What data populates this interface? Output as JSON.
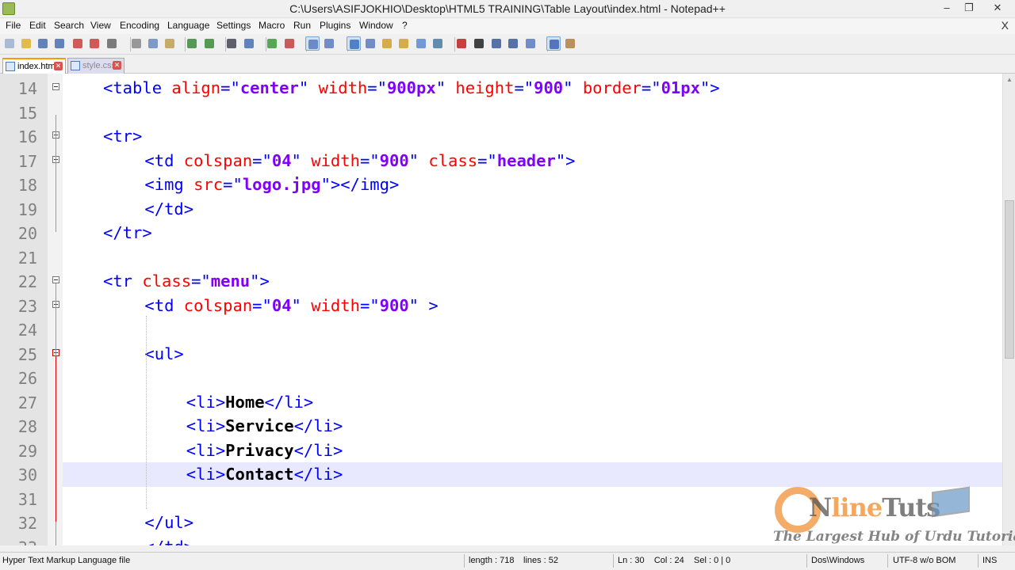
{
  "window": {
    "title": "C:\\Users\\ASIFJOKHIO\\Desktop\\HTML5 TRAINING\\Table Layout\\index.html - Notepad++",
    "controls": {
      "minimize": "–",
      "restore": "❐",
      "close": "✕"
    }
  },
  "menu": {
    "items": [
      "File",
      "Edit",
      "Search",
      "View",
      "Encoding",
      "Language",
      "Settings",
      "Macro",
      "Run",
      "Plugins",
      "Window",
      "?"
    ],
    "close_glyph": "X"
  },
  "tabs": [
    {
      "label": "index.html",
      "active": true
    },
    {
      "label": "style.css",
      "active": false
    }
  ],
  "editor": {
    "current_line": 30,
    "lines": [
      {
        "n": "14",
        "indent": "",
        "tokens": [
          [
            "tg",
            "<table "
          ],
          [
            "at",
            "align"
          ],
          [
            "tg",
            "=\""
          ],
          [
            "st",
            "center"
          ],
          [
            "tg",
            "\" "
          ],
          [
            "at",
            "width"
          ],
          [
            "tg",
            "=\""
          ],
          [
            "st",
            "900px"
          ],
          [
            "tg",
            "\" "
          ],
          [
            "at",
            "height"
          ],
          [
            "tg",
            "=\""
          ],
          [
            "st",
            "900"
          ],
          [
            "tg",
            "\" "
          ],
          [
            "at",
            "border"
          ],
          [
            "tg",
            "=\""
          ],
          [
            "st",
            "01px"
          ],
          [
            "tg",
            "\">"
          ]
        ]
      },
      {
        "n": "15",
        "indent": "",
        "tokens": []
      },
      {
        "n": "16",
        "indent": "",
        "tokens": [
          [
            "tg",
            "<tr>"
          ]
        ]
      },
      {
        "n": "17",
        "indent": "    ",
        "tokens": [
          [
            "tg",
            "<td "
          ],
          [
            "at",
            "colspan"
          ],
          [
            "tg",
            "=\""
          ],
          [
            "st",
            "04"
          ],
          [
            "tg",
            "\" "
          ],
          [
            "at",
            "width"
          ],
          [
            "tg",
            "=\""
          ],
          [
            "st",
            "900"
          ],
          [
            "tg",
            "\" "
          ],
          [
            "at",
            "class"
          ],
          [
            "tg",
            "=\""
          ],
          [
            "st",
            "header"
          ],
          [
            "tg",
            "\">"
          ]
        ]
      },
      {
        "n": "18",
        "indent": "    ",
        "tokens": [
          [
            "tg",
            "<img "
          ],
          [
            "at",
            "src"
          ],
          [
            "tg",
            "=\""
          ],
          [
            "st",
            "logo.jpg"
          ],
          [
            "tg",
            "\"></img>"
          ]
        ]
      },
      {
        "n": "19",
        "indent": "    ",
        "tokens": [
          [
            "tg",
            "</td>"
          ]
        ]
      },
      {
        "n": "20",
        "indent": "",
        "tokens": [
          [
            "tg",
            "</tr>"
          ]
        ]
      },
      {
        "n": "21",
        "indent": "",
        "tokens": []
      },
      {
        "n": "22",
        "indent": "",
        "tokens": [
          [
            "tg",
            "<tr "
          ],
          [
            "at",
            "class"
          ],
          [
            "tg",
            "=\""
          ],
          [
            "st",
            "menu"
          ],
          [
            "tg",
            "\">"
          ]
        ]
      },
      {
        "n": "23",
        "indent": "    ",
        "tokens": [
          [
            "tg",
            "<td "
          ],
          [
            "at",
            "colspan"
          ],
          [
            "tg",
            "=\""
          ],
          [
            "st",
            "04"
          ],
          [
            "tg",
            "\" "
          ],
          [
            "at",
            "width"
          ],
          [
            "tg",
            "=\""
          ],
          [
            "st",
            "900"
          ],
          [
            "tg",
            "\" >"
          ]
        ]
      },
      {
        "n": "24",
        "indent": "",
        "tokens": []
      },
      {
        "n": "25",
        "indent": "    ",
        "tokens": [
          [
            "tg",
            "<ul>"
          ]
        ]
      },
      {
        "n": "26",
        "indent": "",
        "tokens": []
      },
      {
        "n": "27",
        "indent": "        ",
        "tokens": [
          [
            "tg",
            "<li>"
          ],
          [
            "tx",
            "Home"
          ],
          [
            "tg",
            "</li>"
          ]
        ]
      },
      {
        "n": "28",
        "indent": "        ",
        "tokens": [
          [
            "tg",
            "<li>"
          ],
          [
            "tx",
            "Service"
          ],
          [
            "tg",
            "</li>"
          ]
        ]
      },
      {
        "n": "29",
        "indent": "        ",
        "tokens": [
          [
            "tg",
            "<li>"
          ],
          [
            "tx",
            "Privacy"
          ],
          [
            "tg",
            "</li>"
          ]
        ]
      },
      {
        "n": "30",
        "indent": "        ",
        "tokens": [
          [
            "tg",
            "<li>"
          ],
          [
            "tx",
            "Contact"
          ],
          [
            "tg",
            "</li>"
          ]
        ]
      },
      {
        "n": "31",
        "indent": "",
        "tokens": []
      },
      {
        "n": "32",
        "indent": "    ",
        "tokens": [
          [
            "tg",
            "</ul>"
          ]
        ]
      },
      {
        "n": "33",
        "indent": "    ",
        "tokens": [
          [
            "tg",
            "</td>"
          ]
        ]
      }
    ],
    "fold_lines": [
      "14",
      "16",
      "17",
      "22",
      "23",
      "25"
    ],
    "fold_red": [
      "25"
    ]
  },
  "status": {
    "file_type": "Hyper Text Markup Language file",
    "length": "length : 718",
    "lines": "lines : 52",
    "position": "Ln : 30    Col : 24    Sel : 0 | 0",
    "eol": "Dos\\Windows",
    "encoding": "UTF-8 w/o BOM",
    "mode": "INS"
  },
  "watermark": {
    "brand_prefix": "N",
    "brand_mid": "line",
    "brand_suffix": "Tuts",
    "tagline": "The Largest Hub of Urdu Tutorials"
  },
  "colors": {
    "tag": "#0000ff",
    "attribute": "#ff0000",
    "string": "#8000ff",
    "current_line": "#e8e8ff",
    "watermark_accent": "#f08a2a"
  },
  "toolbar_icons": [
    "new-file-icon",
    "open-file-icon",
    "save-icon",
    "save-all-icon",
    "close-icon",
    "close-all-icon",
    "print-icon",
    "cut-icon",
    "copy-icon",
    "paste-icon",
    "undo-icon",
    "redo-icon",
    "find-icon",
    "replace-icon",
    "zoom-in-icon",
    "zoom-out-icon",
    "sync-vertical-icon",
    "sync-horizontal-icon",
    "word-wrap-icon",
    "show-all-chars-icon",
    "indent-guide-icon",
    "user-lang-icon",
    "doc-map-icon",
    "function-list-icon",
    "record-macro-icon",
    "stop-record-icon",
    "play-macro-icon",
    "run-macro-multiple-icon",
    "save-macro-icon",
    "spell-check-icon",
    "spell-check-options-icon"
  ]
}
